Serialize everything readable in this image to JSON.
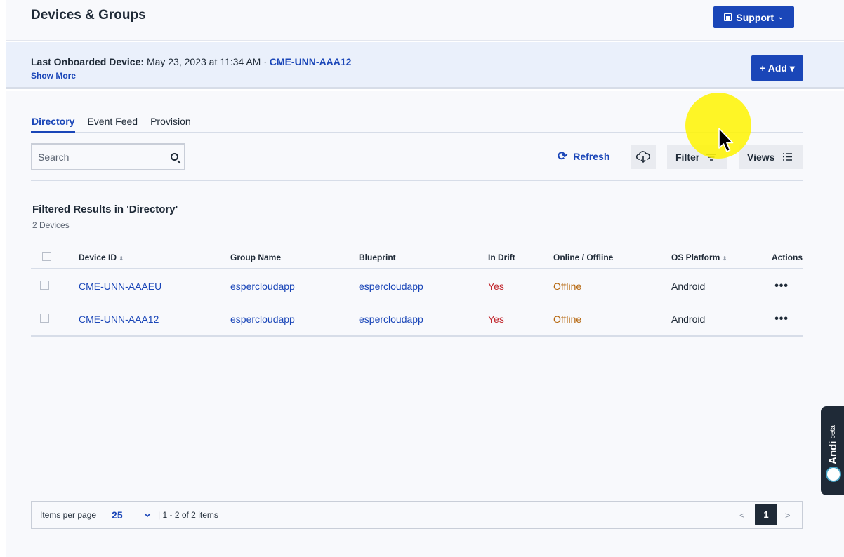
{
  "header": {
    "title": "Devices & Groups",
    "support_label": "Support",
    "support_chevron": "⌄"
  },
  "banner": {
    "label": "Last Onboarded Device:",
    "date": "May 23, 2023 at 11:34 AM",
    "separator": "·",
    "device_link": "CME-UNN-AAA12",
    "show_more": "Show More",
    "add_label": "+ Add ▾"
  },
  "tabs": [
    {
      "label": "Directory",
      "active": true
    },
    {
      "label": "Event Feed",
      "active": false
    },
    {
      "label": "Provision",
      "active": false
    }
  ],
  "toolbar": {
    "search_placeholder": "Search",
    "refresh_label": "Refresh",
    "filter_label": "Filter",
    "views_label": "Views"
  },
  "results": {
    "title": "Filtered Results in 'Directory'",
    "count": "2 Devices"
  },
  "table": {
    "columns": [
      "Device ID",
      "Group Name",
      "Blueprint",
      "In Drift",
      "Online / Offline",
      "OS Platform",
      "Actions"
    ],
    "rows": [
      {
        "device_id": "CME-UNN-AAAEU",
        "group": "espercloudapp",
        "blueprint": "espercloudapp",
        "in_drift": "Yes",
        "status": "Offline",
        "os": "Android",
        "actions": "•••"
      },
      {
        "device_id": "CME-UNN-AAA12",
        "group": "espercloudapp",
        "blueprint": "espercloudapp",
        "in_drift": "Yes",
        "status": "Offline",
        "os": "Android",
        "actions": "•••"
      }
    ]
  },
  "pagination": {
    "items_per_page_label": "Items per page",
    "per_page": "25",
    "range": "| 1 - 2 of 2 items",
    "prev": "<",
    "current_page": "1",
    "next": ">"
  },
  "andi": {
    "name": "Andi",
    "badge": "beta"
  },
  "colors": {
    "primary": "#1a46b8",
    "drift_yes": "#c1272d",
    "offline": "#b5650b",
    "cursor_highlight": "#fff400"
  }
}
